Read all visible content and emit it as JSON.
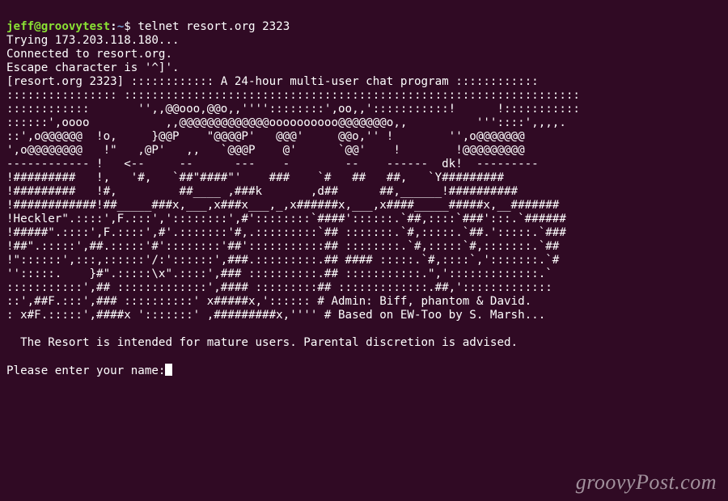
{
  "prompt": {
    "user": "jeff",
    "at": "@",
    "host": "groovytest",
    "sep": ":",
    "path": "~",
    "dollar": "$ ",
    "command": "telnet resort.org 2323"
  },
  "connect_lines": [
    "Trying 173.203.118.180...",
    "Connected to resort.org.",
    "Escape character is '^]'."
  ],
  "banner_header": "[resort.org 2323] :::::::::::: A 24-hour multi-user chat program ::::::::::::",
  "ascii_art": [
    ":::::::::::::::: ::::::::::::::::::::::::::::::::::::::::::::::::::::::::::::::::::",
    "::::::::::::       '',,@@ooo,@@o,,''''::::::::',oo,,':::::::::::!      !:::::::::::",
    "::::::',oooo           ,,@@@@@@@@@@@@@oooooooooo@@@@@@@o,,          '''::::',,,,.",
    "::',o@@@@@@  !o,     }@@P    \"@@@@P'   @@@'     @@o,'' !        '',o@@@@@@@",
    "',o@@@@@@@@   !\"   ,@P'   ,,   `@@@P    @'      `@@'    !        !@@@@@@@@@",
    "------------ !   <--     --      ---    -        --    ------  dk!  ---------",
    "!#########   !,   '#,   `##\"####\"'    ###    `#   ##   ##,   `Y#########",
    "!#########   !#,         ##____ ,###k       ,d##      ##,______!##########",
    "!############!##_____###x,___,x###x___,_,x######x,___,x####_____#####x,__#######",
    "!Heckler\".::::',F.:::','::::::::',#'::::::::`####'::::::.`##,::::`###':::.`######",
    "!#####\".::::',F.::::',#'.:::::::'#,.:::::::::`## :::::::.`#,:::::.`##.':::::.`###",
    "!##\".:::::',##.:::::'#'::::::::'##':::::::::::## ::::::::.`#,:::::`#,:::::::.`##",
    "!\"::::::',:::,::::::'/:'::::::',###.:::::::::.## #### :::::.`#,::::`,':::::::.`#",
    "'':::::.    }#\".:::::\\x\".::::',### ::::::::::.## :::::::::::.\",':::::::::::::.`",
    ":::::::::::',## :::::::::::::',#### :::::::::## :::::::::::::.##,':::::::::::::",
    "::',##F.:::',### ::::::::::' x#####x,':::::: # Admin: Biff, phantom & David.",
    ": x#F.:::::',####x ':::::::' ,#########x,'''' # Based on EW-Too by S. Marsh..."
  ],
  "notice_blank": "",
  "notice": "  The Resort is intended for mature users. Parental discretion is advised.",
  "blank2": "",
  "input_prompt": "Please enter your name:",
  "watermark": "groovyPost.com"
}
